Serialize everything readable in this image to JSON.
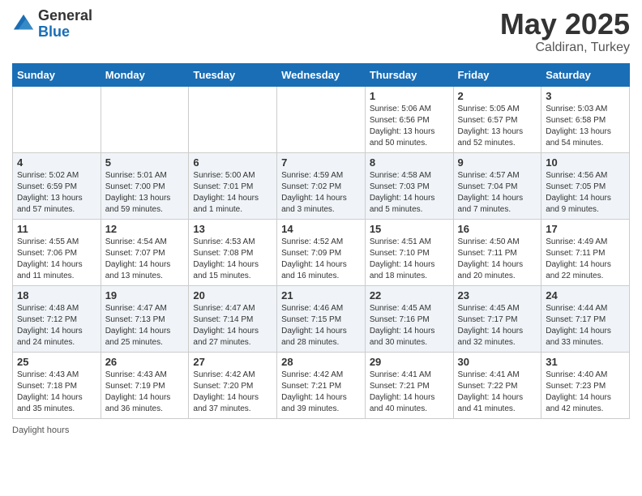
{
  "logo": {
    "general": "General",
    "blue": "Blue"
  },
  "title": {
    "month": "May 2025",
    "location": "Caldiran, Turkey"
  },
  "days_of_week": [
    "Sunday",
    "Monday",
    "Tuesday",
    "Wednesday",
    "Thursday",
    "Friday",
    "Saturday"
  ],
  "weeks": [
    [
      {
        "day": "",
        "detail": ""
      },
      {
        "day": "",
        "detail": ""
      },
      {
        "day": "",
        "detail": ""
      },
      {
        "day": "",
        "detail": ""
      },
      {
        "day": "1",
        "detail": "Sunrise: 5:06 AM\nSunset: 6:56 PM\nDaylight: 13 hours and 50 minutes."
      },
      {
        "day": "2",
        "detail": "Sunrise: 5:05 AM\nSunset: 6:57 PM\nDaylight: 13 hours and 52 minutes."
      },
      {
        "day": "3",
        "detail": "Sunrise: 5:03 AM\nSunset: 6:58 PM\nDaylight: 13 hours and 54 minutes."
      }
    ],
    [
      {
        "day": "4",
        "detail": "Sunrise: 5:02 AM\nSunset: 6:59 PM\nDaylight: 13 hours and 57 minutes."
      },
      {
        "day": "5",
        "detail": "Sunrise: 5:01 AM\nSunset: 7:00 PM\nDaylight: 13 hours and 59 minutes."
      },
      {
        "day": "6",
        "detail": "Sunrise: 5:00 AM\nSunset: 7:01 PM\nDaylight: 14 hours and 1 minute."
      },
      {
        "day": "7",
        "detail": "Sunrise: 4:59 AM\nSunset: 7:02 PM\nDaylight: 14 hours and 3 minutes."
      },
      {
        "day": "8",
        "detail": "Sunrise: 4:58 AM\nSunset: 7:03 PM\nDaylight: 14 hours and 5 minutes."
      },
      {
        "day": "9",
        "detail": "Sunrise: 4:57 AM\nSunset: 7:04 PM\nDaylight: 14 hours and 7 minutes."
      },
      {
        "day": "10",
        "detail": "Sunrise: 4:56 AM\nSunset: 7:05 PM\nDaylight: 14 hours and 9 minutes."
      }
    ],
    [
      {
        "day": "11",
        "detail": "Sunrise: 4:55 AM\nSunset: 7:06 PM\nDaylight: 14 hours and 11 minutes."
      },
      {
        "day": "12",
        "detail": "Sunrise: 4:54 AM\nSunset: 7:07 PM\nDaylight: 14 hours and 13 minutes."
      },
      {
        "day": "13",
        "detail": "Sunrise: 4:53 AM\nSunset: 7:08 PM\nDaylight: 14 hours and 15 minutes."
      },
      {
        "day": "14",
        "detail": "Sunrise: 4:52 AM\nSunset: 7:09 PM\nDaylight: 14 hours and 16 minutes."
      },
      {
        "day": "15",
        "detail": "Sunrise: 4:51 AM\nSunset: 7:10 PM\nDaylight: 14 hours and 18 minutes."
      },
      {
        "day": "16",
        "detail": "Sunrise: 4:50 AM\nSunset: 7:11 PM\nDaylight: 14 hours and 20 minutes."
      },
      {
        "day": "17",
        "detail": "Sunrise: 4:49 AM\nSunset: 7:11 PM\nDaylight: 14 hours and 22 minutes."
      }
    ],
    [
      {
        "day": "18",
        "detail": "Sunrise: 4:48 AM\nSunset: 7:12 PM\nDaylight: 14 hours and 24 minutes."
      },
      {
        "day": "19",
        "detail": "Sunrise: 4:47 AM\nSunset: 7:13 PM\nDaylight: 14 hours and 25 minutes."
      },
      {
        "day": "20",
        "detail": "Sunrise: 4:47 AM\nSunset: 7:14 PM\nDaylight: 14 hours and 27 minutes."
      },
      {
        "day": "21",
        "detail": "Sunrise: 4:46 AM\nSunset: 7:15 PM\nDaylight: 14 hours and 28 minutes."
      },
      {
        "day": "22",
        "detail": "Sunrise: 4:45 AM\nSunset: 7:16 PM\nDaylight: 14 hours and 30 minutes."
      },
      {
        "day": "23",
        "detail": "Sunrise: 4:45 AM\nSunset: 7:17 PM\nDaylight: 14 hours and 32 minutes."
      },
      {
        "day": "24",
        "detail": "Sunrise: 4:44 AM\nSunset: 7:17 PM\nDaylight: 14 hours and 33 minutes."
      }
    ],
    [
      {
        "day": "25",
        "detail": "Sunrise: 4:43 AM\nSunset: 7:18 PM\nDaylight: 14 hours and 35 minutes."
      },
      {
        "day": "26",
        "detail": "Sunrise: 4:43 AM\nSunset: 7:19 PM\nDaylight: 14 hours and 36 minutes."
      },
      {
        "day": "27",
        "detail": "Sunrise: 4:42 AM\nSunset: 7:20 PM\nDaylight: 14 hours and 37 minutes."
      },
      {
        "day": "28",
        "detail": "Sunrise: 4:42 AM\nSunset: 7:21 PM\nDaylight: 14 hours and 39 minutes."
      },
      {
        "day": "29",
        "detail": "Sunrise: 4:41 AM\nSunset: 7:21 PM\nDaylight: 14 hours and 40 minutes."
      },
      {
        "day": "30",
        "detail": "Sunrise: 4:41 AM\nSunset: 7:22 PM\nDaylight: 14 hours and 41 minutes."
      },
      {
        "day": "31",
        "detail": "Sunrise: 4:40 AM\nSunset: 7:23 PM\nDaylight: 14 hours and 42 minutes."
      }
    ]
  ],
  "footer": {
    "daylight_label": "Daylight hours"
  }
}
